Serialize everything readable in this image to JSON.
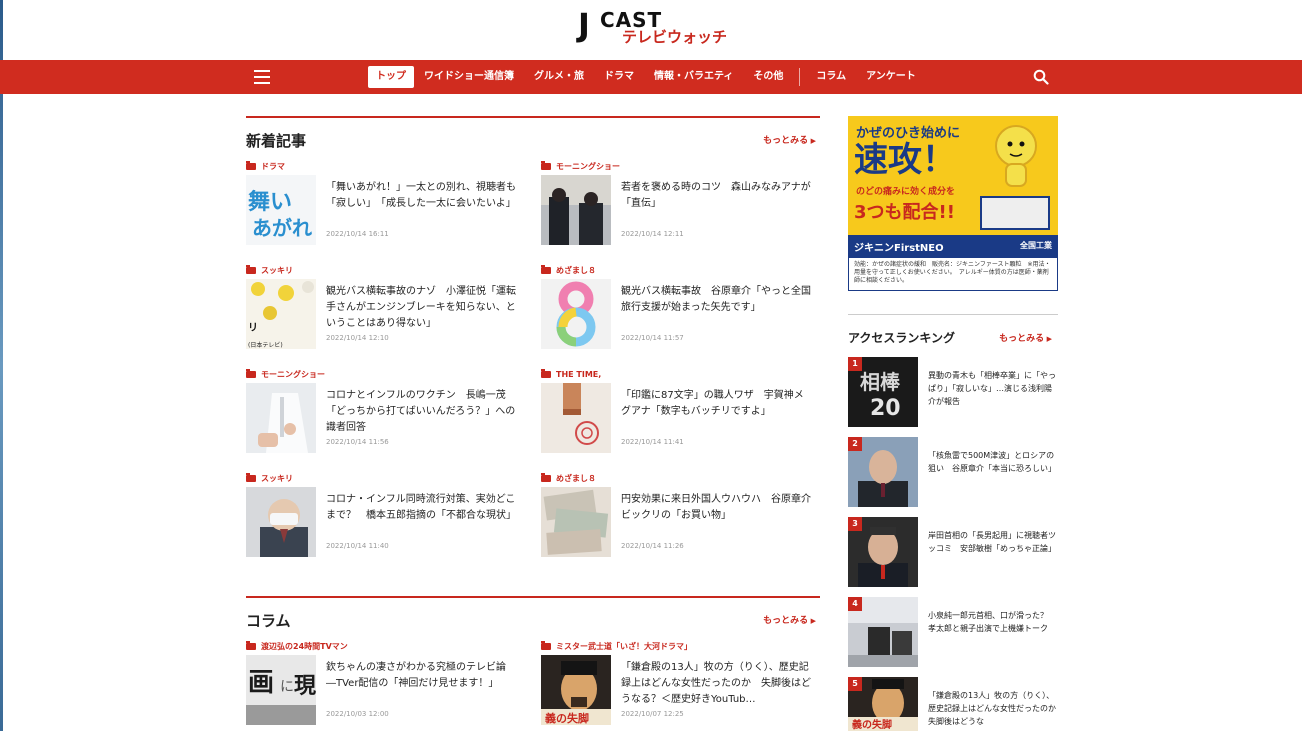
{
  "logo": {
    "j": "J",
    "cast": "CAST",
    "sub": "テレビウォッチ"
  },
  "nav": {
    "items": [
      "トップ",
      "ワイドショー通信簿",
      "グルメ・旅",
      "ドラマ",
      "情報・バラエティ",
      "その他",
      "コラム",
      "アンケート"
    ]
  },
  "new_articles": {
    "title": "新着記事",
    "more": "もっとみる",
    "items": [
      {
        "category": "ドラマ",
        "title": "「舞いあがれ！」一太との別れ、視聴者も「寂しい」　「成長した一太に会いたいよ」",
        "date": "2022/10/14 16:11",
        "thumb_text": "舞い あがれ"
      },
      {
        "category": "モーニングショー",
        "title": "若者を褒める時のコツ　森山みなみアナが「直伝」",
        "date": "2022/10/14 12:11"
      },
      {
        "category": "スッキリ",
        "title": "観光バス横転事故のナゾ　小澤征悦「運転手さんがエンジンブレーキを知らない、ということはあり得ない」",
        "date": "2022/10/14 12:10",
        "thumb_text": "リ (日本テレビ)"
      },
      {
        "category": "めざまし８",
        "title": "観光バス横転事故　谷原章介「やっと全国旅行支援が始まった矢先です」",
        "date": "2022/10/14 11:57"
      },
      {
        "category": "モーニングショー",
        "title": "コロナとインフルのワクチン　長嶋一茂「どっちから打てばいいんだろう？」への識者回答",
        "date": "2022/10/14 11:56"
      },
      {
        "category": "THE TIME,",
        "title": "「印鑑に87文字」の職人ワザ　宇賀神メグアナ「数字もバッチリですよ」",
        "date": "2022/10/14 11:41"
      },
      {
        "category": "スッキリ",
        "title": "コロナ・インフル同時流行対策、実効どこまで？　橋本五郎指摘の「不都合な現状」",
        "date": "2022/10/14 11:40"
      },
      {
        "category": "めざまし８",
        "title": "円安効果に来日外国人ウハウハ　谷原章介ビックリの「お買い物」",
        "date": "2022/10/14 11:26"
      }
    ]
  },
  "column": {
    "title": "コラム",
    "more": "もっとみる",
    "items": [
      {
        "category": "渡辺弘の24時間TVマン",
        "title": "欽ちゃんの凄さがわかる究極のテレビ論―TVer配信の「神回だけ見せます！」",
        "date": "2022/10/03 12:00",
        "thumb_text": "画 に 現"
      },
      {
        "category": "ミスター武士道「いざ！大河ドラマ」",
        "title": "「鎌倉殿の13人」牧の方（りく）、歴史記録上はどんな女性だったのか　失脚後はどうなる？＜歴史好きYouTub…",
        "date": "2022/10/07 12:25",
        "thumb_text": "義の失脚"
      }
    ]
  },
  "ad": {
    "line1": "かぜのひき始めに",
    "big": "速攻！",
    "line2": "のどの痛みに効く成分を",
    "line3": "3つも配合!!",
    "brand": "ジキニンFirstNEO",
    "brand2": "全国工業",
    "foot": "効能：かぜの諸症状の緩和　販売名：ジキニンファースト顆粒　※用法・用量を守って正しくお使いください。　アレルギー体質の方は医師・薬剤師に相談ください。"
  },
  "ranking": {
    "title": "アクセスランキング",
    "more": "もっとみる",
    "items": [
      {
        "num": "1",
        "text": "異動の青木も「相棒卒業」に「やっぱり」「寂しいな」…演じる浅利陽介が報告",
        "thumb_text": "相棒 20"
      },
      {
        "num": "2",
        "text": "「核魚雷で500M津波」とロシアの狙い　谷原章介「本当に恐ろしい」"
      },
      {
        "num": "3",
        "text": "岸田首相の「長男起用」に視聴者ツッコミ　安部敏樹「めっちゃ正論」"
      },
      {
        "num": "4",
        "text": "小泉純一郎元首相、口が滑った？　孝太郎と親子出演で上機嫌トーク"
      },
      {
        "num": "5",
        "text": "「鎌倉殿の13人」牧の方（りく）、歴史記録上はどんな女性だったのか　失脚後はどうな",
        "thumb_text": "義の失脚"
      }
    ]
  },
  "colors": {
    "brand_red": "#d02c1f",
    "ad_yellow": "#f7c91c",
    "ad_navy": "#1a3a86"
  }
}
